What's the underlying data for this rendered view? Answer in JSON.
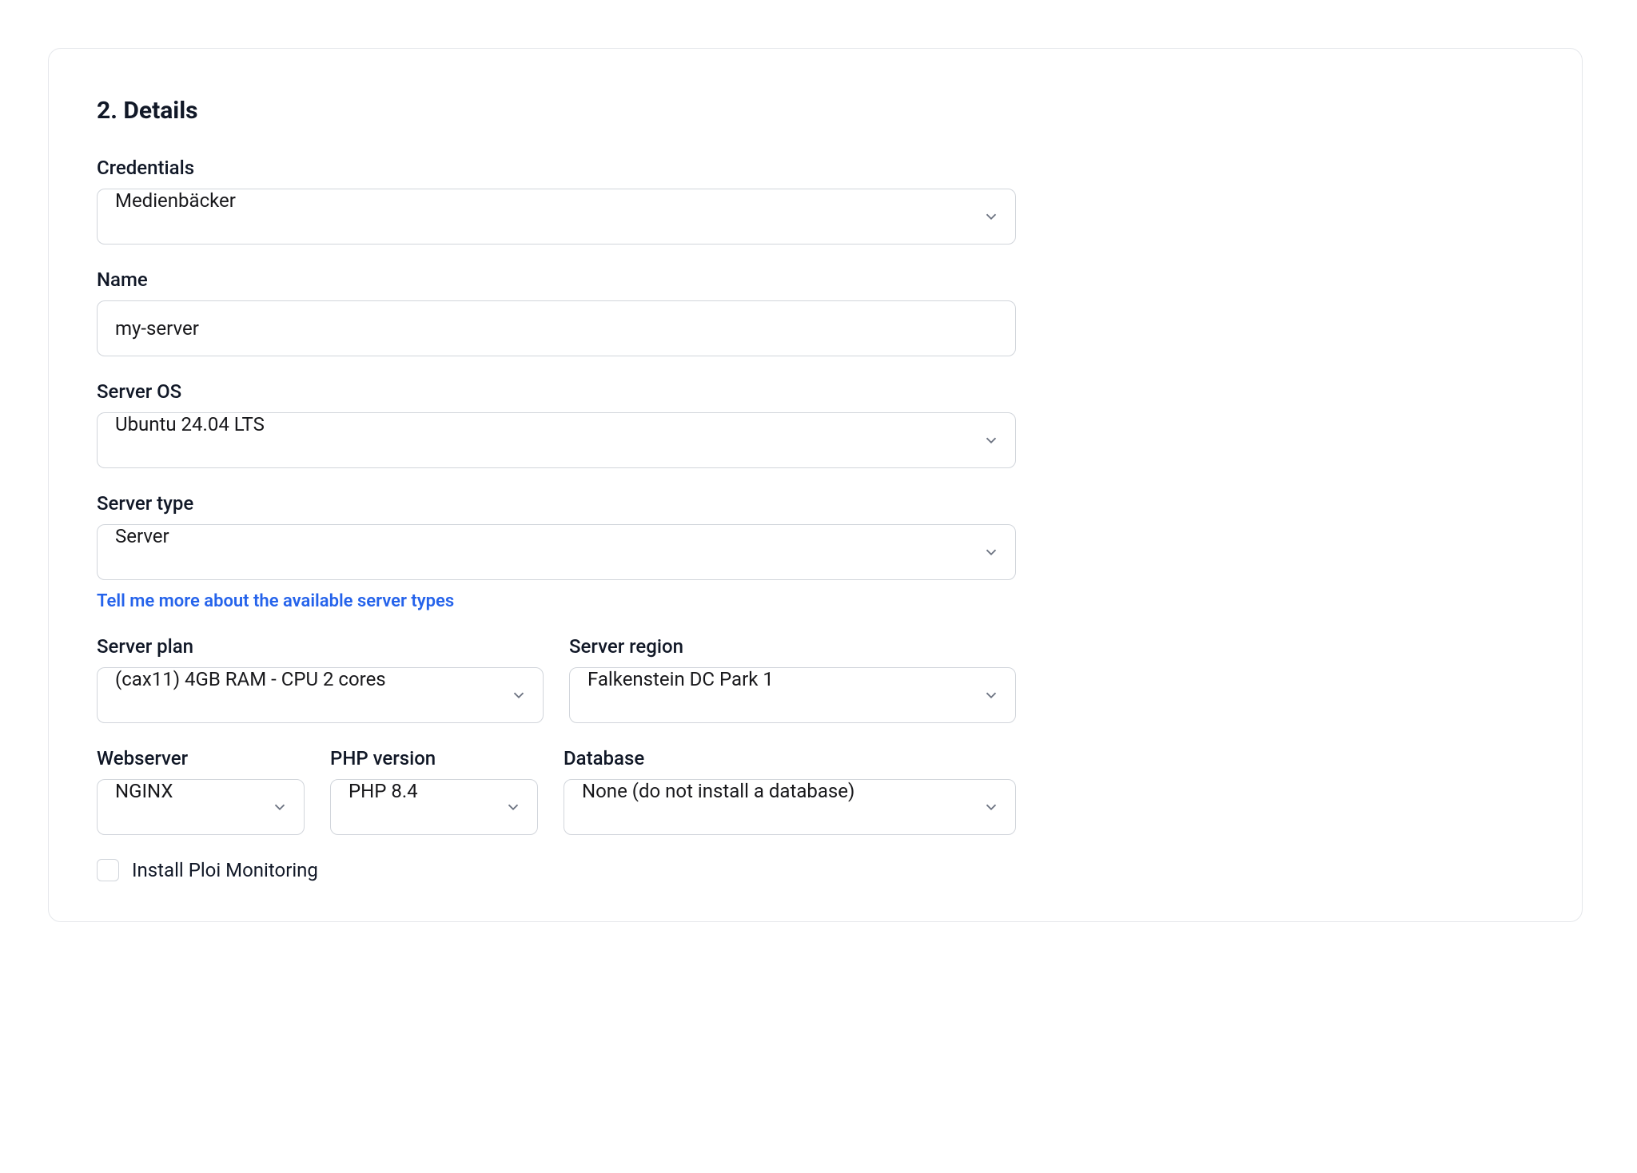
{
  "section": {
    "title": "2. Details"
  },
  "fields": {
    "credentials": {
      "label": "Credentials",
      "value": "Medienbäcker"
    },
    "name": {
      "label": "Name",
      "value": "my-server"
    },
    "server_os": {
      "label": "Server OS",
      "value": "Ubuntu 24.04 LTS"
    },
    "server_type": {
      "label": "Server type",
      "value": "Server",
      "help_link": "Tell me more about the available server types"
    },
    "server_plan": {
      "label": "Server plan",
      "value": "(cax11) 4GB RAM - CPU 2 cores"
    },
    "server_region": {
      "label": "Server region",
      "value": "Falkenstein DC Park 1"
    },
    "webserver": {
      "label": "Webserver",
      "value": "NGINX"
    },
    "php_version": {
      "label": "PHP version",
      "value": "PHP 8.4"
    },
    "database": {
      "label": "Database",
      "value": "None (do not install a database)"
    },
    "monitoring": {
      "label": "Install Ploi Monitoring",
      "checked": false
    }
  }
}
